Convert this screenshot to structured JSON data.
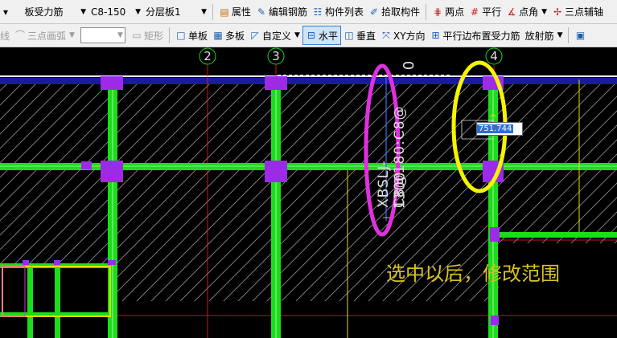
{
  "toolbar1": {
    "component_type": "板受力筋",
    "spec": "C8-150",
    "layer": "分层板1",
    "properties": "属性",
    "edit_rebar": "编辑钢筋",
    "component_list": "构件列表",
    "pick_component": "拾取构件",
    "two_points": "两点",
    "parallel": "平行",
    "point_angle": "点角",
    "three_point_axis": "三点辅轴"
  },
  "toolbar2": {
    "line": "线",
    "three_point_arc": "三点画弧",
    "rectangle": "矩形",
    "single_slab": "单板",
    "multi_slab": "多板",
    "custom": "自定义",
    "horizontal": "水平",
    "vertical": "垂直",
    "xy_direction": "XY方向",
    "parallel_edge": "平行边布置受力筋",
    "radial_rebar": "放射筋"
  },
  "canvas": {
    "axis_labels": [
      "2",
      "3",
      "4"
    ],
    "rebar_label": "XBSLJ-C8@180:C8@",
    "dim_1300": "1300",
    "dim_0": "0",
    "dim_input_value": "751.744",
    "caption": "选中以后，修改范围"
  },
  "colors": {
    "background": "#000000",
    "beam": "#1cdc1c",
    "wall": "#1a1a9c",
    "column": "#9c2ae6",
    "axis": "#ff2020",
    "magenta_mark": "#e030e0",
    "yellow_mark": "#f5f500",
    "slab_line": "#e0e000"
  }
}
